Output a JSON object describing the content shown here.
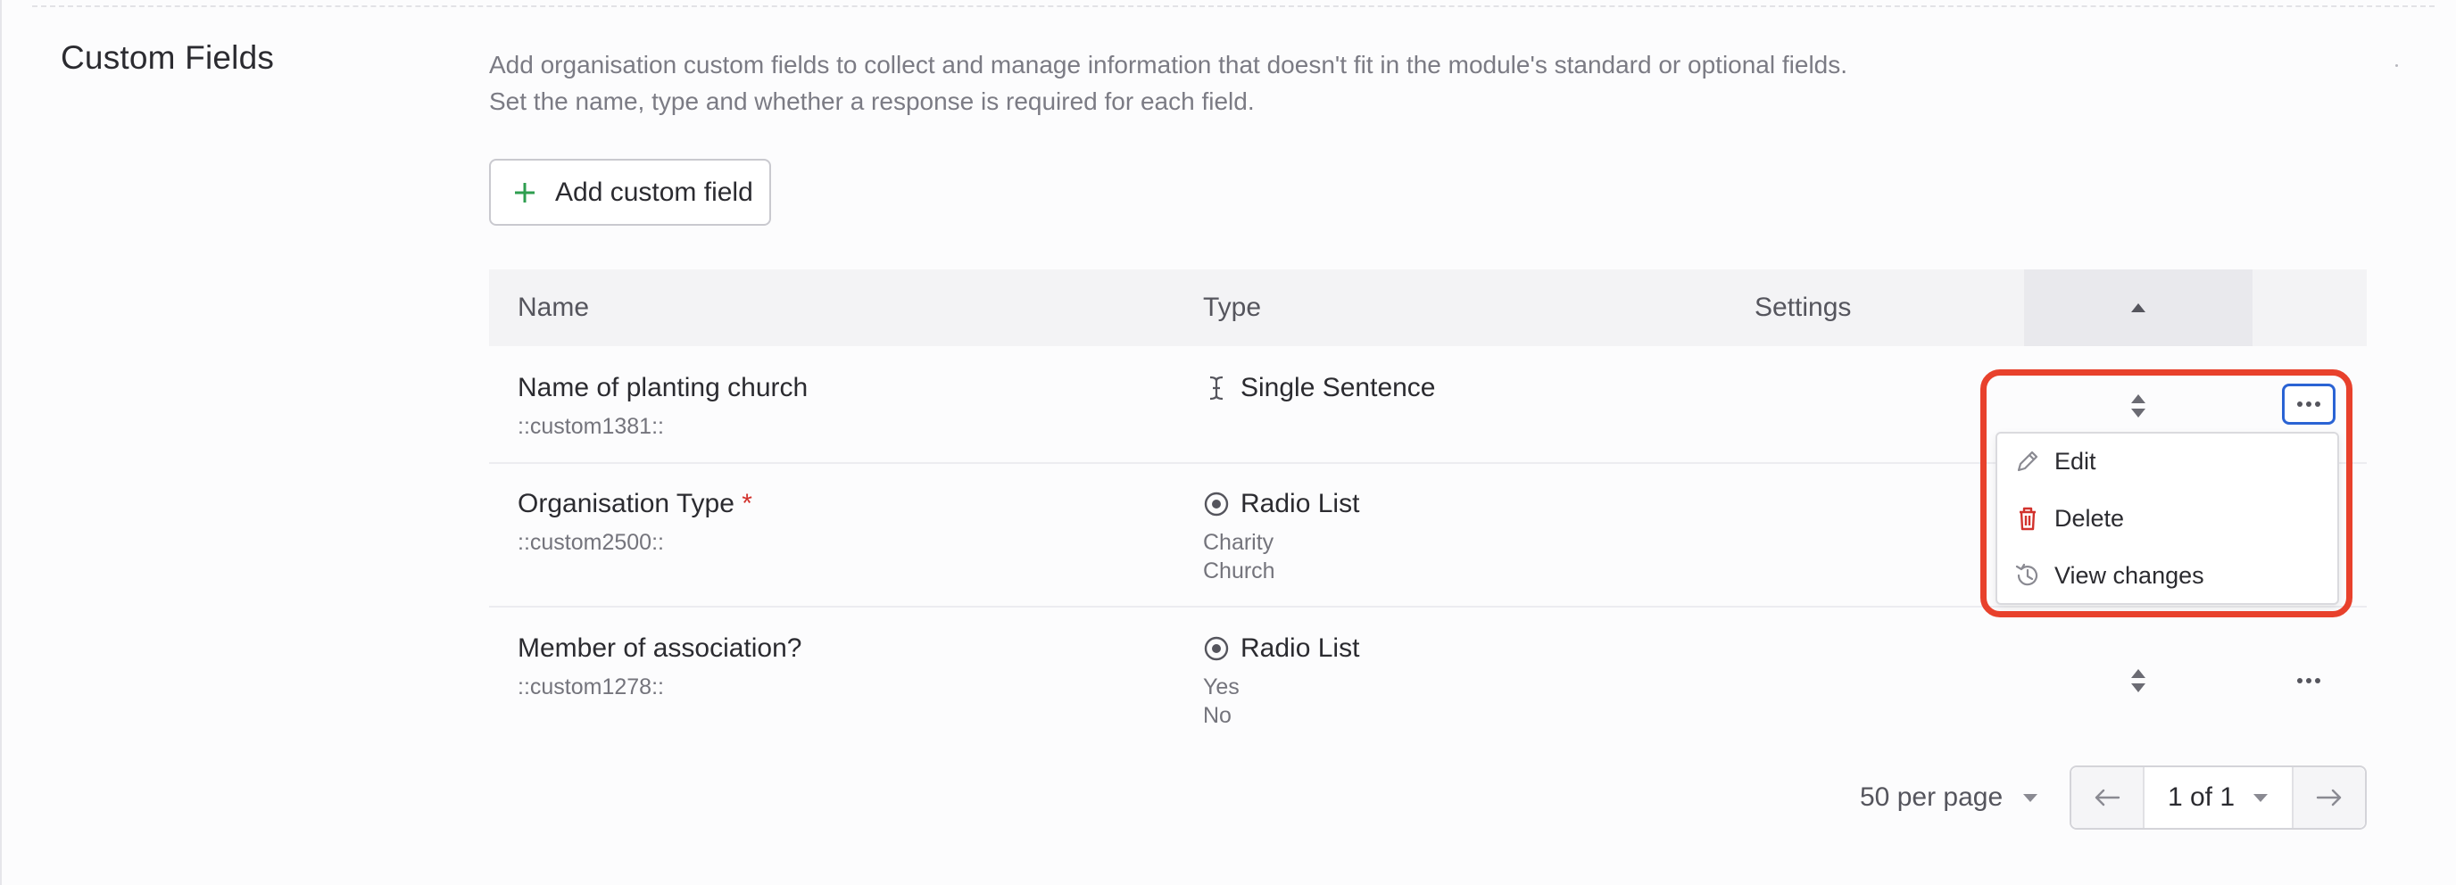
{
  "section": {
    "title": "Custom Fields",
    "description": "Add organisation custom fields to collect and manage information that doesn't fit in the module's standard or optional fields. Set the name, type and whether a response is required for each field."
  },
  "add_button": {
    "label": "Add custom field",
    "icon": "plus-icon"
  },
  "table": {
    "columns": {
      "name": "Name",
      "type": "Type",
      "settings": "Settings"
    },
    "rows": [
      {
        "name": "Name of planting church",
        "required": false,
        "key": "::custom1381::",
        "type_icon": "text-cursor-icon",
        "type": "Single Sentence",
        "options": []
      },
      {
        "name": "Organisation Type",
        "required": true,
        "required_mark": "*",
        "key": "::custom2500::",
        "type_icon": "radio-icon",
        "type": "Radio List",
        "options": [
          "Charity",
          "Church"
        ]
      },
      {
        "name": "Member of association?",
        "required": false,
        "key": "::custom1278::",
        "type_icon": "radio-icon",
        "type": "Radio List",
        "options": [
          "Yes",
          "No"
        ]
      }
    ]
  },
  "context_menu": {
    "items": [
      {
        "label": "Edit",
        "icon": "pencil-icon"
      },
      {
        "label": "Delete",
        "icon": "trash-icon"
      },
      {
        "label": "View changes",
        "icon": "history-icon"
      }
    ]
  },
  "pagination": {
    "per_page": "50 per page",
    "page": "1 of 1"
  },
  "colors": {
    "highlight": "#e8412c",
    "focus": "#2a63d4",
    "plus": "#2e9e4f",
    "danger": "#d2322d"
  }
}
